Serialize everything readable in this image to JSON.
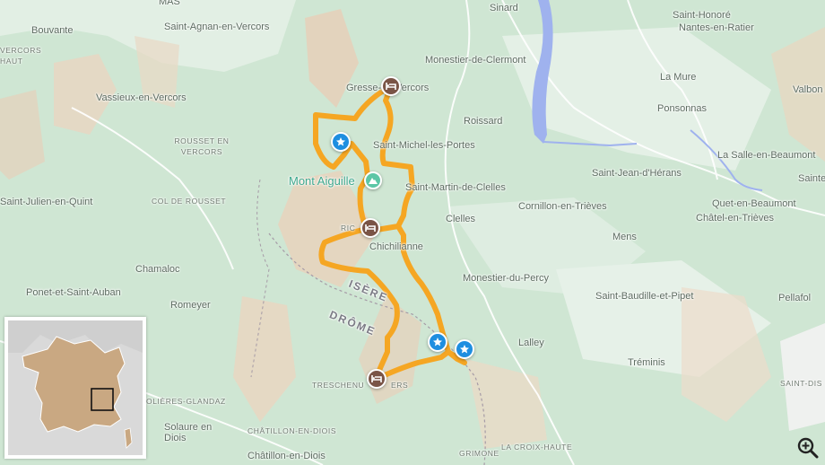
{
  "map": {
    "places": {
      "mas": "MAS",
      "sinard": "Sinard",
      "bouvante": "Bouvante",
      "vassieux": "Vassieux-en-Vercors",
      "saint_agnan": "Saint-Agnan-en-Vercors",
      "saint_julien": "Saint-Julien-en-Quint",
      "chamaloc": "Chamaloc",
      "ponet": "Ponet-et-Saint-Auban",
      "romeyer": "Romeyer",
      "solaure": "Solaure en Diois",
      "chatillon": "Châtillon-en-Diois",
      "monestier_clermont": "Monestier-de-Clermont",
      "roissard": "Roissard",
      "gresse": "Gresse-en-Vercors",
      "saint_michel": "Saint-Michel-les-Portes",
      "saint_martin": "Saint-Martin-de-Clelles",
      "clelles": "Clelles",
      "chichilianne": "Chichilianne",
      "monestier_percy": "Monestier-du-Percy",
      "cornillon": "Cornillon-en-Trièves",
      "mens": "Mens",
      "saint_baudille": "Saint-Baudille-et-Pipet",
      "lalley": "Lalley",
      "treminis": "Tréminis",
      "saint_honore": "Saint-Honoré",
      "nantes": "Nantes-en-Ratier",
      "la_mure": "La Mure",
      "ponsonnas": "Ponsonnas",
      "valbonnais": "Valbon",
      "la_salle": "La Salle-en-Beaumont",
      "saint_jean": "Saint-Jean-d'Hérans",
      "quet": "Quet-en-Beaumont",
      "saint_e": "Sainte",
      "chatel": "Châtel-en-Trièves",
      "pellafol": "Pellafol",
      "ric": "RIC",
      "treschenu": "TRESCHENU",
      "ers": "ERS"
    },
    "regions": {
      "rousset": "ROUSSET EN VERCORS",
      "col_rousset": "COL DE ROUSSET",
      "vercors_haut": "VERCORS HAUT",
      "glandaz": "OLIÈRES-GLANDAZ",
      "chatillon_r": "CHÂTILLON-EN-DIOIS",
      "grimone": "GRIMONE",
      "croix_haute": "LA CROIX-HAUTE",
      "saint_disdier": "SAINT-DIS"
    },
    "departments": {
      "isere": "ISÈRE",
      "drome": "DRÔME"
    },
    "peak": "Mont Aiguille",
    "colors": {
      "route": "#f5a623",
      "hotel": "#7a5446",
      "star": "#1e8ee0",
      "peak": "#5cc6a6",
      "water": "#9fb2ee"
    },
    "markers": [
      {
        "kind": "hotel",
        "name": "hotel-gresse"
      },
      {
        "kind": "hotel",
        "name": "hotel-richardiere"
      },
      {
        "kind": "hotel",
        "name": "hotel-treschenu"
      },
      {
        "kind": "star",
        "name": "highlight-west"
      },
      {
        "kind": "star",
        "name": "highlight-south-1"
      },
      {
        "kind": "star",
        "name": "highlight-south-2"
      },
      {
        "kind": "peak",
        "name": "peak-mont-aiguille"
      }
    ],
    "zoom_icon": "zoom-in-icon",
    "inset_country": "France"
  }
}
